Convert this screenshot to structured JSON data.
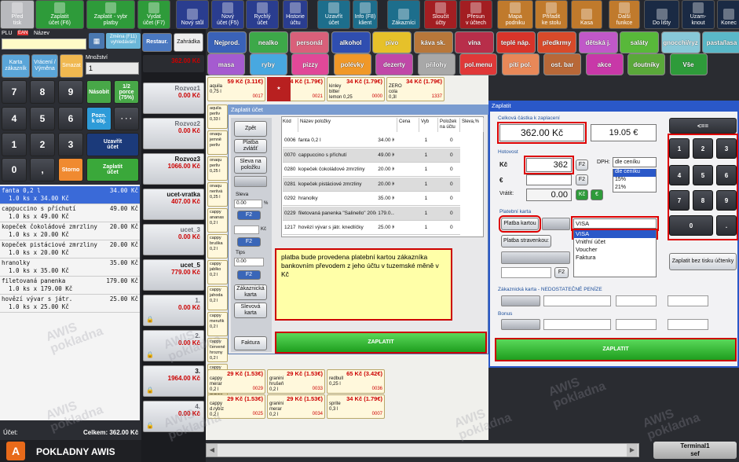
{
  "toolbar": [
    {
      "label": "Před\ntisk",
      "color": "#b8b9bd"
    },
    {
      "label": "Zaplatit\núčet (F6)",
      "color": "#2e9b3a"
    },
    {
      "label": "Zaplatit - vybr\nplatby",
      "color": "#2e9b3a"
    },
    {
      "label": "Vydat\núčet (F7)",
      "color": "#2e9b3a"
    },
    {
      "label": "Nový stůl",
      "color": "#2a3d8f"
    },
    {
      "label": "Nový\núčet (F5)",
      "color": "#2a3d8f"
    },
    {
      "label": "Rychlý\núčet",
      "color": "#2a3d8f"
    },
    {
      "label": "Historie\núčtu",
      "color": "#2a3d8f"
    },
    {
      "label": "Uzavřít\núčet",
      "color": "#1d6e8c"
    },
    {
      "label": "Info (F8)\nklient",
      "color": "#1d6e8c"
    },
    {
      "label": "Zákazníci",
      "color": "#1d6e8c"
    },
    {
      "label": "Sloučit\núčty",
      "color": "#a31e22"
    },
    {
      "label": "Přesun\nv účtech",
      "color": "#a31e22"
    },
    {
      "label": "Mapa\npodniku",
      "color": "#c07a2c"
    },
    {
      "label": "Přiřadit\nke stolu",
      "color": "#c07a2c"
    },
    {
      "label": "Kasa",
      "color": "#c07a2c"
    },
    {
      "label": "Další\nfunkce",
      "color": "#c07a2c"
    },
    {
      "label": "Do lišty",
      "color": "#1a2a44"
    },
    {
      "label": "Uzam-\nknout",
      "color": "#1a2a44"
    },
    {
      "label": "Konec",
      "color": "#1a2a44"
    }
  ],
  "plu": {
    "plu_label": "PLU",
    "ean_label": "EAN",
    "name_label": "Název",
    "change_label": "Změna (F11)\nvyhledávání",
    "qty_label": "Množství",
    "qty_value": "1"
  },
  "left_buttons": {
    "card": "Karta\nzákazník",
    "refund": "Vrácení /\nVýměna",
    "storno_top": "Smazat",
    "nasobit": "Násobit",
    "porce": "1/2\nporce\n(75%)",
    "pozn": "Pozn.\nk obj.",
    "uzavrit": "Uzavřít\núčet",
    "storno": "Storno",
    "zaplatit": "Zaplatit\núčet"
  },
  "keypad": [
    "7",
    "8",
    "9",
    "4",
    "5",
    "6",
    "1",
    "2",
    "3",
    "0",
    ","
  ],
  "order_items": [
    {
      "l1": "fanta 0,2 l",
      "l2": "  1.0 ks x 34.00 Kč",
      "v": "34.00 Kč"
    },
    {
      "l1": "cappuccino s příchutí",
      "l2": "  1.0 ks x 49.00 Kč",
      "v": "49.00 Kč"
    },
    {
      "l1": "kopeček čokoládové zmrzliny",
      "l2": "  1.0 ks x 20.00 Kč",
      "v": "20.00 Kč"
    },
    {
      "l1": "kopeček pistáciové zmrzliny",
      "l2": "  1.0 ks x 20.00 Kč",
      "v": "20.00 Kč"
    },
    {
      "l1": "hranolky",
      "l2": "  1.0 ks x 35.00 Kč",
      "v": "35.00 Kč"
    },
    {
      "l1": "filetovaná panenka",
      "l2": "  1.0 ks x 179.00 Kč",
      "v": "179.00 Kč"
    },
    {
      "l1": "hovězí vývar s játr.",
      "l2": "  1.0 ks x 25.00 Kč",
      "v": "25.00 Kč"
    }
  ],
  "footer": {
    "ucet": "Účet:",
    "celkem": "Celkem: 362.00 Kč",
    "brand": "POKLADNY AWIS",
    "terminal": "Terminal1\nsef"
  },
  "tabs": {
    "restaur": "Restaur.",
    "zahradka": "Zahrádka"
  },
  "accounts": [
    {
      "name": "",
      "val": "362.00 Kč",
      "sel": true
    },
    {
      "name": "Rozvoz1",
      "val": "0.00 Kč"
    },
    {
      "name": "Rozvoz2",
      "val": "0.00 Kč"
    },
    {
      "name": "Rozvoz3",
      "val": "1066.00 Kč"
    },
    {
      "name": "ucet-vratka",
      "val": "407.00 Kč"
    },
    {
      "name": "ucet_3",
      "val": "0.00 Kč"
    },
    {
      "name": "ucet_5",
      "val": "779.00 Kč"
    },
    {
      "name": "1.",
      "val": "0.00 Kč"
    },
    {
      "name": "2.",
      "val": "0.00 Kč"
    },
    {
      "name": "3.",
      "val": "1964.00 Kč"
    },
    {
      "name": "4.",
      "val": "0.00 Kč"
    }
  ],
  "categories": [
    {
      "t": "Nejprod.",
      "c": "#3a62b8"
    },
    {
      "t": "nealko",
      "c": "#3da849"
    },
    {
      "t": "personál",
      "c": "#d9607a"
    },
    {
      "t": "alkohol",
      "c": "#2f4eb0"
    },
    {
      "t": "pivo",
      "c": "#e6c12a"
    },
    {
      "t": "káva sk.",
      "c": "#b8773a"
    },
    {
      "t": "vína",
      "c": "#b82e4a"
    },
    {
      "t": "teplé náp.",
      "c": "#d8342a"
    },
    {
      "t": "předkrmy",
      "c": "#d84a2a"
    },
    {
      "t": "dětská j.",
      "c": "#c058c8"
    },
    {
      "t": "saláty",
      "c": "#58b83a"
    },
    {
      "t": "gnocchi/ryz",
      "c": "#88c8d8"
    },
    {
      "t": "pasta/lasa",
      "c": "#5ab8c8"
    },
    {
      "t": "masa",
      "c": "#a55bd0"
    },
    {
      "t": "ryby",
      "c": "#48a8e0"
    },
    {
      "t": "pizzy",
      "c": "#e04898"
    },
    {
      "t": "polévky",
      "c": "#f09828"
    },
    {
      "t": "dezerty",
      "c": "#c048a8"
    },
    {
      "t": "přílohy",
      "c": "#a8a8a8"
    },
    {
      "t": "pol.menu",
      "c": "#e03838"
    },
    {
      "t": "pití pol.",
      "c": "#e88858"
    },
    {
      "t": "ost. bar",
      "c": "#b86838"
    },
    {
      "t": "akce",
      "c": "#c838a8"
    },
    {
      "t": "doutníky",
      "c": "#5aa83a"
    },
    {
      "t": "Vše",
      "c": "#2e9b3a"
    }
  ],
  "products": [
    {
      "p": "59 Kč (3.11€)",
      "n": "aquila\n0,75 l",
      "c": "0017"
    },
    {
      "p": "34 Kč (1.79€)",
      "n": "",
      "c": "0021"
    },
    {
      "p": "34 Kč (1.79€)",
      "n": "kinley\nbitter\nlemon 0,25",
      "c": "0000"
    },
    {
      "p": "34 Kč (1.79€)",
      "n": "ZERO\ncola\n0,3l",
      "c": "1337"
    },
    {
      "p": "29 Kč (1.53€)",
      "n": "cappy\nmerar\n0,2 l",
      "c": "0029"
    },
    {
      "p": "29 Kč (1.53€)",
      "n": "granini\nhrušeň\n0,2 l",
      "c": "0033"
    },
    {
      "p": "65 Kč (3.42€)",
      "n": "redbull\n0,25 l",
      "c": "0036"
    },
    {
      "p": "29 Kč (1.53€)",
      "n": "cappy\nd.rybíz\n0,2 l",
      "c": "0025"
    },
    {
      "p": "29 Kč (1.53€)",
      "n": "granini\nmerar\n0,2 l",
      "c": "0034"
    },
    {
      "p": "34 Kč (1.79€)",
      "n": "sprite\n0,3 l",
      "c": "0007"
    }
  ],
  "left_col_items": [
    "aquila\nperliv\n0,33 l",
    "onaqu\njemně\nperliv",
    "onaqu\nperliv\n0,25 l",
    "onaqu\nneriivá\n0,25 l",
    "cappy\nananas\n0,2 l",
    "cappy\nbruška\n0,2 l",
    "cappy\njablko\n0,2 l",
    "cappy\njahoda\n0,2 l",
    "cappy\nmeruňk\n0,2 l",
    "cappy\nčervené\nhrozny\n0,2 l",
    "cappy\nmerar\n0,2 l",
    "granini\nmerar\n0,2 l"
  ],
  "dlg1": {
    "title": "Zaplatit účet",
    "zpet": "Zpět",
    "zvlast": "Platba zvlášť",
    "sleva_pol": "Sleva na\npoložku",
    "sleva_label": "Sleva",
    "sleva_val": "0.00",
    "f2": "F2",
    "kc": "Kč",
    "tips_label": "Tips",
    "tips_val": "0.00",
    "zak_karta": "Zákaznická\nkarta",
    "slev_karta": "Slevová\nkarta",
    "faktura": "Faktura",
    "zaplatit": "ZAPLATIT",
    "cols": [
      "Kód",
      "Název položky",
      "Cena",
      "Vyb",
      "Položek\nna účtu",
      "Sleva,%"
    ],
    "rows": [
      {
        "k": "0006",
        "n": "fanta 0,2 l",
        "c": "34.00 Kč",
        "q": "1",
        "s": "0"
      },
      {
        "k": "0070",
        "n": "cappuccino s příchutí",
        "c": "49.00 Kč",
        "q": "1",
        "s": "0"
      },
      {
        "k": "0280",
        "n": "kopeček čokoládové zmrzliny",
        "c": "20.00 Kč",
        "q": "1",
        "s": "0"
      },
      {
        "k": "0281",
        "n": "kopeček pistáciové zmrzliny",
        "c": "20.00 Kč",
        "q": "1",
        "s": "0"
      },
      {
        "k": "0292",
        "n": "hranolky",
        "c": "35.00 Kč",
        "q": "1",
        "s": "0"
      },
      {
        "k": "0229",
        "n": "filetovaná panenka \"Salinello\" 200g",
        "c": "179.0...",
        "q": "1",
        "s": "0"
      },
      {
        "k": "1217",
        "n": "hovězí vývar s játr. knedlíčky",
        "c": "25.00 Kč",
        "q": "1",
        "s": "0"
      }
    ],
    "note": "platba bude provedena platební kartou zákazníka bankovním převodem z jeho účtu v tuzemské měně v Kč"
  },
  "dlg2": {
    "title": "Zaplatit",
    "total_label": "Celková částka k zaplacení",
    "total": "362.00 Kč",
    "eur": "19.05 €",
    "hotovost": "Hotovost",
    "kc": "Kč",
    "cash": "362",
    "f2": "F2",
    "eur_sym": "€",
    "vratit": "Vrátit:",
    "vratit_val": "0.00",
    "kc_btn": "Kč",
    "eur_btn": "€",
    "dph": "DPH:",
    "dph_sel": "dle ceníku",
    "dph_opts": [
      "dle ceníku",
      "15%",
      "21%"
    ],
    "platebni": "Platební karta",
    "platba_kartou": "Platba kartou",
    "card_input": "VISA",
    "card_opts": [
      "VISA",
      "Vnitřní účet",
      "Voucher",
      "Faktura"
    ],
    "stravenkou": "Platba stravenkou:",
    "zak_karta": "Zákaznická karta  -  NEDOSTATEČNÉ PENÍZE",
    "bonus": "Bonus",
    "back": "<==",
    "numpad": [
      "1",
      "2",
      "3",
      "4",
      "5",
      "6",
      "7",
      "8",
      "9",
      "0",
      "."
    ],
    "bez_tisku": "Zaplatit bez tisku účtenky",
    "zaplatit": "ZAPLATIT"
  },
  "watermark": "AWIS\npokladna"
}
